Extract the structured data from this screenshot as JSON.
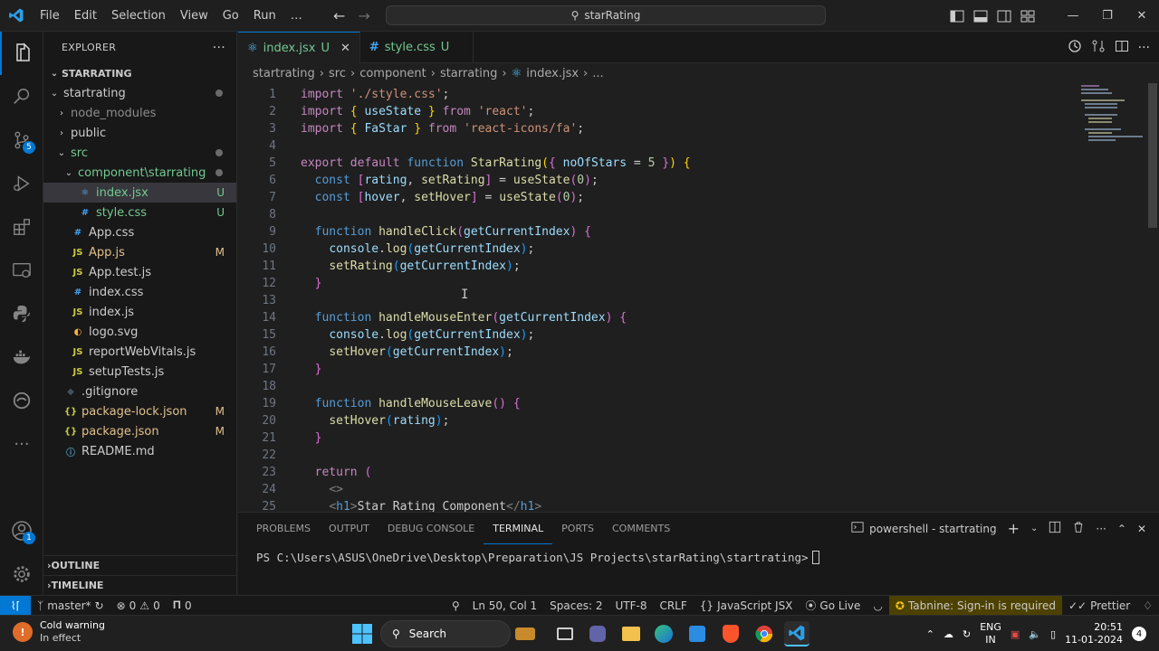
{
  "titlebar": {
    "menu": [
      "File",
      "Edit",
      "Selection",
      "View",
      "Go",
      "Run",
      "…"
    ],
    "search_text": "starRating"
  },
  "activity": {
    "source_control_badge": "5",
    "accounts_badge": "1"
  },
  "sidebar": {
    "title": "EXPLORER",
    "more": "···",
    "root": "STARRATING",
    "items": [
      {
        "label": "startrating",
        "type": "folder",
        "open": true,
        "depth": 1,
        "status": "dot"
      },
      {
        "label": "node_modules",
        "type": "folder",
        "open": false,
        "depth": 2,
        "status": "",
        "dim": true
      },
      {
        "label": "public",
        "type": "folder",
        "open": false,
        "depth": 2,
        "status": ""
      },
      {
        "label": "src",
        "type": "folder",
        "open": true,
        "depth": 2,
        "status": "dot",
        "color": "#73c991"
      },
      {
        "label": "component\\starrating",
        "type": "folder",
        "open": true,
        "depth": 3,
        "status": "dot",
        "color": "#73c991"
      },
      {
        "label": "index.jsx",
        "type": "jsx",
        "depth": 4,
        "status": "U",
        "color": "#73c991",
        "selected": true
      },
      {
        "label": "style.css",
        "type": "css",
        "depth": 4,
        "status": "U",
        "color": "#73c991"
      },
      {
        "label": "App.css",
        "type": "css",
        "depth": 3,
        "status": ""
      },
      {
        "label": "App.js",
        "type": "js",
        "depth": 3,
        "status": "M",
        "color": "#e2c08d"
      },
      {
        "label": "App.test.js",
        "type": "js",
        "depth": 3,
        "status": ""
      },
      {
        "label": "index.css",
        "type": "css",
        "depth": 3,
        "status": ""
      },
      {
        "label": "index.js",
        "type": "js",
        "depth": 3,
        "status": ""
      },
      {
        "label": "logo.svg",
        "type": "svg",
        "depth": 3,
        "status": ""
      },
      {
        "label": "reportWebVitals.js",
        "type": "js",
        "depth": 3,
        "status": ""
      },
      {
        "label": "setupTests.js",
        "type": "js",
        "depth": 3,
        "status": ""
      },
      {
        "label": ".gitignore",
        "type": "git",
        "depth": 2,
        "status": ""
      },
      {
        "label": "package-lock.json",
        "type": "json",
        "depth": 2,
        "status": "M",
        "color": "#e2c08d"
      },
      {
        "label": "package.json",
        "type": "json",
        "depth": 2,
        "status": "M",
        "color": "#e2c08d"
      },
      {
        "label": "README.md",
        "type": "md",
        "depth": 2,
        "status": ""
      }
    ],
    "outline": "OUTLINE",
    "timeline": "TIMELINE"
  },
  "tabs": [
    {
      "name": "index.jsx",
      "status": "U",
      "active": true
    },
    {
      "name": "style.css",
      "status": "U",
      "active": false
    }
  ],
  "breadcrumb": [
    "startrating",
    "src",
    "component",
    "starrating",
    "index.jsx",
    "..."
  ],
  "code": {
    "lines": [
      [
        [
          "kw",
          "import"
        ],
        [
          "punc",
          " "
        ],
        [
          "str",
          "'./style.css'"
        ],
        [
          "punc",
          ";"
        ]
      ],
      [
        [
          "kw",
          "import"
        ],
        [
          "punc",
          " "
        ],
        [
          "br1",
          "{"
        ],
        [
          "punc",
          " "
        ],
        [
          "var",
          "useState"
        ],
        [
          "punc",
          " "
        ],
        [
          "br1",
          "}"
        ],
        [
          "punc",
          " "
        ],
        [
          "kw",
          "from"
        ],
        [
          "punc",
          " "
        ],
        [
          "str",
          "'react'"
        ],
        [
          "punc",
          ";"
        ]
      ],
      [
        [
          "kw",
          "import"
        ],
        [
          "punc",
          " "
        ],
        [
          "br1",
          "{"
        ],
        [
          "punc",
          " "
        ],
        [
          "var",
          "FaStar"
        ],
        [
          "punc",
          " "
        ],
        [
          "br1",
          "}"
        ],
        [
          "punc",
          " "
        ],
        [
          "kw",
          "from"
        ],
        [
          "punc",
          " "
        ],
        [
          "str",
          "'react-icons/fa'"
        ],
        [
          "punc",
          ";"
        ]
      ],
      [],
      [
        [
          "kw",
          "export"
        ],
        [
          "punc",
          " "
        ],
        [
          "kw",
          "default"
        ],
        [
          "punc",
          " "
        ],
        [
          "kw2",
          "function"
        ],
        [
          "punc",
          " "
        ],
        [
          "fn",
          "StarRating"
        ],
        [
          "br1",
          "("
        ],
        [
          "br2",
          "{"
        ],
        [
          "punc",
          " "
        ],
        [
          "var",
          "noOfStars"
        ],
        [
          "punc",
          " = "
        ],
        [
          "num",
          "5"
        ],
        [
          "punc",
          " "
        ],
        [
          "br2",
          "}"
        ],
        [
          "br1",
          ")"
        ],
        [
          "punc",
          " "
        ],
        [
          "br1",
          "{"
        ]
      ],
      [
        [
          "punc",
          "  "
        ],
        [
          "kw2",
          "const"
        ],
        [
          "punc",
          " "
        ],
        [
          "br2",
          "["
        ],
        [
          "var",
          "rating"
        ],
        [
          "punc",
          ", "
        ],
        [
          "fn",
          "setRating"
        ],
        [
          "br2",
          "]"
        ],
        [
          "punc",
          " = "
        ],
        [
          "fn",
          "useState"
        ],
        [
          "br2",
          "("
        ],
        [
          "num",
          "0"
        ],
        [
          "br2",
          ")"
        ],
        [
          "punc",
          ";"
        ]
      ],
      [
        [
          "punc",
          "  "
        ],
        [
          "kw2",
          "const"
        ],
        [
          "punc",
          " "
        ],
        [
          "br2",
          "["
        ],
        [
          "var",
          "hover"
        ],
        [
          "punc",
          ", "
        ],
        [
          "fn",
          "setHover"
        ],
        [
          "br2",
          "]"
        ],
        [
          "punc",
          " = "
        ],
        [
          "fn",
          "useState"
        ],
        [
          "br2",
          "("
        ],
        [
          "num",
          "0"
        ],
        [
          "br2",
          ")"
        ],
        [
          "punc",
          ";"
        ]
      ],
      [],
      [
        [
          "punc",
          "  "
        ],
        [
          "kw2",
          "function"
        ],
        [
          "punc",
          " "
        ],
        [
          "fn",
          "handleClick"
        ],
        [
          "br2",
          "("
        ],
        [
          "var",
          "getCurrentIndex"
        ],
        [
          "br2",
          ")"
        ],
        [
          "punc",
          " "
        ],
        [
          "br2",
          "{"
        ]
      ],
      [
        [
          "punc",
          "    "
        ],
        [
          "var",
          "console"
        ],
        [
          "punc",
          "."
        ],
        [
          "fn",
          "log"
        ],
        [
          "br3",
          "("
        ],
        [
          "var",
          "getCurrentIndex"
        ],
        [
          "br3",
          ")"
        ],
        [
          "punc",
          ";"
        ]
      ],
      [
        [
          "punc",
          "    "
        ],
        [
          "fn",
          "setRating"
        ],
        [
          "br3",
          "("
        ],
        [
          "var",
          "getCurrentIndex"
        ],
        [
          "br3",
          ")"
        ],
        [
          "punc",
          ";"
        ]
      ],
      [
        [
          "punc",
          "  "
        ],
        [
          "br2",
          "}"
        ]
      ],
      [],
      [
        [
          "punc",
          "  "
        ],
        [
          "kw2",
          "function"
        ],
        [
          "punc",
          " "
        ],
        [
          "fn",
          "handleMouseEnter"
        ],
        [
          "br2",
          "("
        ],
        [
          "var",
          "getCurrentIndex"
        ],
        [
          "br2",
          ")"
        ],
        [
          "punc",
          " "
        ],
        [
          "br2",
          "{"
        ]
      ],
      [
        [
          "punc",
          "    "
        ],
        [
          "var",
          "console"
        ],
        [
          "punc",
          "."
        ],
        [
          "fn",
          "log"
        ],
        [
          "br3",
          "("
        ],
        [
          "var",
          "getCurrentIndex"
        ],
        [
          "br3",
          ")"
        ],
        [
          "punc",
          ";"
        ]
      ],
      [
        [
          "punc",
          "    "
        ],
        [
          "fn",
          "setHover"
        ],
        [
          "br3",
          "("
        ],
        [
          "var",
          "getCurrentIndex"
        ],
        [
          "br3",
          ")"
        ],
        [
          "punc",
          ";"
        ]
      ],
      [
        [
          "punc",
          "  "
        ],
        [
          "br2",
          "}"
        ]
      ],
      [],
      [
        [
          "punc",
          "  "
        ],
        [
          "kw2",
          "function"
        ],
        [
          "punc",
          " "
        ],
        [
          "fn",
          "handleMouseLeave"
        ],
        [
          "br2",
          "()"
        ],
        [
          "punc",
          " "
        ],
        [
          "br2",
          "{"
        ]
      ],
      [
        [
          "punc",
          "    "
        ],
        [
          "fn",
          "setHover"
        ],
        [
          "br3",
          "("
        ],
        [
          "var",
          "rating"
        ],
        [
          "br3",
          ")"
        ],
        [
          "punc",
          ";"
        ]
      ],
      [
        [
          "punc",
          "  "
        ],
        [
          "br2",
          "}"
        ]
      ],
      [],
      [
        [
          "punc",
          "  "
        ],
        [
          "kw",
          "return"
        ],
        [
          "punc",
          " "
        ],
        [
          "br2",
          "("
        ]
      ],
      [
        [
          "punc",
          "    "
        ],
        [
          "tagsub",
          "<>"
        ]
      ],
      [
        [
          "punc",
          "    "
        ],
        [
          "tagsub",
          "<"
        ],
        [
          "tag",
          "h1"
        ],
        [
          "tagsub",
          ">"
        ],
        [
          "punc",
          "Star Rating Component"
        ],
        [
          "tagsub",
          "</"
        ],
        [
          "tag",
          "h1"
        ],
        [
          "tagsub",
          ">"
        ]
      ]
    ]
  },
  "panel": {
    "tabs": [
      "PROBLEMS",
      "OUTPUT",
      "DEBUG CONSOLE",
      "TERMINAL",
      "PORTS",
      "COMMENTS"
    ],
    "active_tab": "TERMINAL",
    "terminal_name": "powershell - startrating",
    "prompt": "PS C:\\Users\\ASUS\\OneDrive\\Desktop\\Preparation\\JS Projects\\starRating\\startrating>"
  },
  "statusbar": {
    "branch": "master*",
    "errors": "0",
    "warnings": "0",
    "ports": "0",
    "position": "Ln 50, Col 1",
    "spaces": "Spaces: 2",
    "encoding": "UTF-8",
    "eol": "CRLF",
    "language": "JavaScript JSX",
    "golive": "Go Live",
    "tabnine": "Tabnine: Sign-in is required",
    "prettier": "Prettier"
  },
  "taskbar": {
    "weather_title": "Cold warning",
    "weather_sub": "In effect",
    "weather_badge": "!",
    "search": "Search",
    "lang_top": "ENG",
    "lang_bottom": "IN",
    "time": "20:51",
    "date": "11-01-2024",
    "notification_count": "4"
  },
  "colors": {
    "accent": "#0078d4",
    "git_untracked": "#73c991",
    "git_modified": "#e2c08d"
  }
}
